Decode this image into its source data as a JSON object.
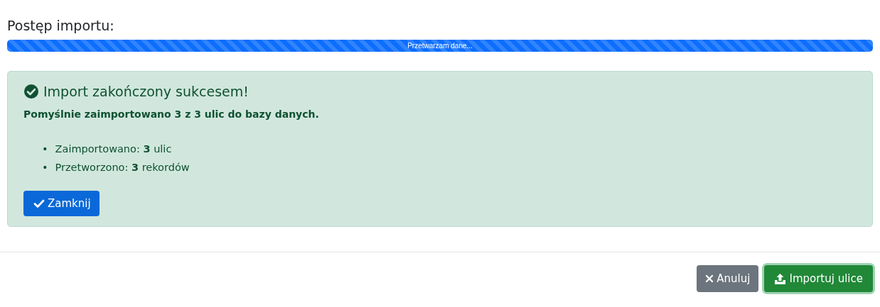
{
  "progress": {
    "title": "Postęp importu:",
    "label": "Przetwarzam dane...",
    "level": 1
  },
  "alert": {
    "title": "Import zakończony sukcesem!",
    "message": "Pomyślnie zaimportowano 3 z 3 ulic do bazy danych.",
    "items": [
      {
        "bullet": "•",
        "text": "Zaimportowano: **3** ulic"
      },
      {
        "bullet": "•",
        "text": "Przetworzono: **3** rekordów"
      }
    ],
    "button": "Zamknij"
  },
  "footer": {
    "buttons": [
      {
        "label": "Anuluj",
        "kind": "cancel"
      },
      {
        "label": "Importuj ulice",
        "kind": "import"
      }
    ]
  }
}
